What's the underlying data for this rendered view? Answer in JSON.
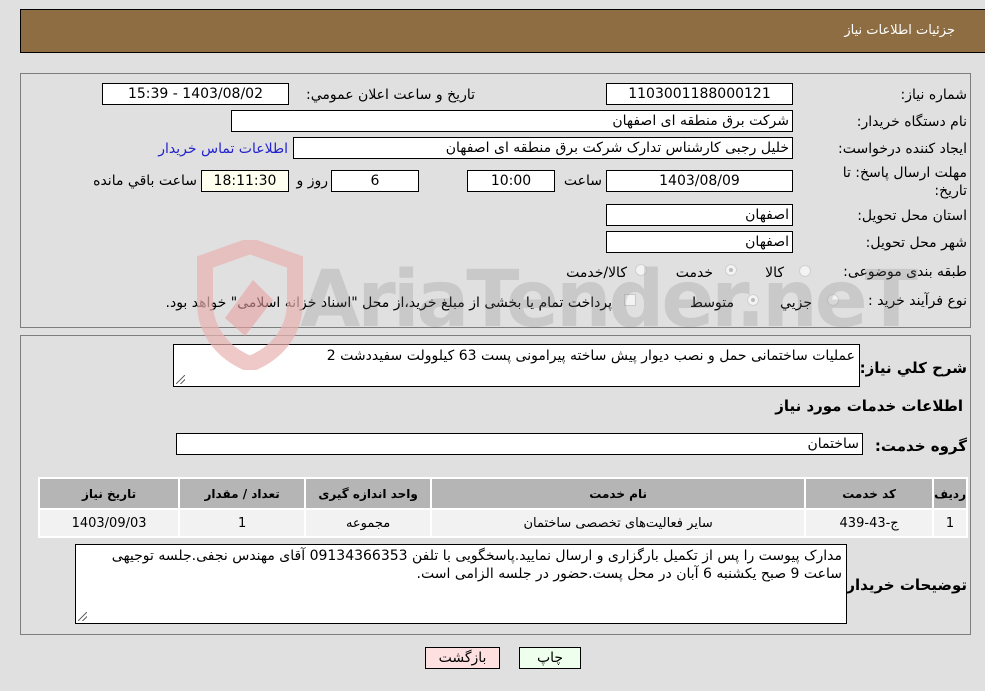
{
  "header": {
    "title": "جزئیات اطلاعات نیاز"
  },
  "details": {
    "need_number": {
      "label": "شماره نیاز:",
      "value": "1103001188000121"
    },
    "announce_datetime": {
      "label": "تاریخ و ساعت اعلان عمومي:",
      "value": "1403/08/02 - 15:39"
    },
    "buyer_org": {
      "label": "نام دستگاه خریدار:",
      "value": "شرکت برق منطقه ای اصفهان"
    },
    "requester": {
      "label": "ایجاد کننده درخواست:",
      "value": "خلیل رجبی کارشناس تدارک شرکت برق منطقه ای اصفهان"
    },
    "buyer_contact_link": "اطلاعات تماس خریدار",
    "deadline": {
      "label_line1": "مهلت ارسال پاسخ: تا",
      "label_line2": "تاریخ:",
      "date": "1403/08/09",
      "time_label": "ساعت",
      "time": "10:00",
      "days": "6",
      "days_label": "روز و",
      "remaining": "18:11:30",
      "remaining_label": "ساعت باقي مانده"
    },
    "province": {
      "label": "استان محل تحویل:",
      "value": "اصفهان"
    },
    "city": {
      "label": "شهر محل تحویل:",
      "value": "اصفهان"
    },
    "category": {
      "label": "طبقه بندی موضوعی:",
      "options": [
        "کالا",
        "خدمت",
        "کالا/خدمت"
      ],
      "selected": "خدمت"
    },
    "purchase_type": {
      "label": "نوع فرآیند خرید :",
      "options": [
        "جزيي",
        "متوسط"
      ],
      "selected": "متوسط",
      "treasury_note": "پرداخت تمام یا بخشی از مبلغ خرید،از محل \"اسناد خزانه اسلامی\" خواهد بود."
    }
  },
  "summary": {
    "label": "شرح كلي نياز:",
    "value": "عملیات ساختمانی حمل و نصب دیوار پیش ساخته پیرامونی پست 63 کیلوولت سفیددشت 2"
  },
  "services": {
    "section_title": "اطلاعات خدمات مورد نیاز",
    "group_label": "گروه خدمت:",
    "group_value": "ساختمان",
    "table": {
      "headers": [
        "ردیف",
        "کد خدمت",
        "نام خدمت",
        "واحد اندازه گیری",
        "تعداد / مقدار",
        "تاریخ نیاز"
      ],
      "rows": [
        [
          "1",
          "ج-43-439",
          "سایر فعالیت‌های تخصصی ساختمان",
          "مجموعه",
          "1",
          "1403/09/03"
        ]
      ]
    }
  },
  "buyer_notes": {
    "label": "توضیحات خریدار:",
    "value": "مدارک پیوست را پس از تکمیل بارگزاری و ارسال نمایید.پاسخگویی با تلفن 09134366353  آقای مهندس نجفی.جلسه توجیهی ساعت 9 صبح یکشنبه 6 آبان در محل پست.حضور در جلسه الزامی است."
  },
  "buttons": {
    "print": "چاپ",
    "back": "بازگشت"
  },
  "watermark": {
    "text": "AriaTender.neT"
  },
  "colors": {
    "header_bg": "#8e6d43",
    "print_bg": "#eeffee",
    "back_bg": "#ffe0e0",
    "link": "#2222cc"
  }
}
